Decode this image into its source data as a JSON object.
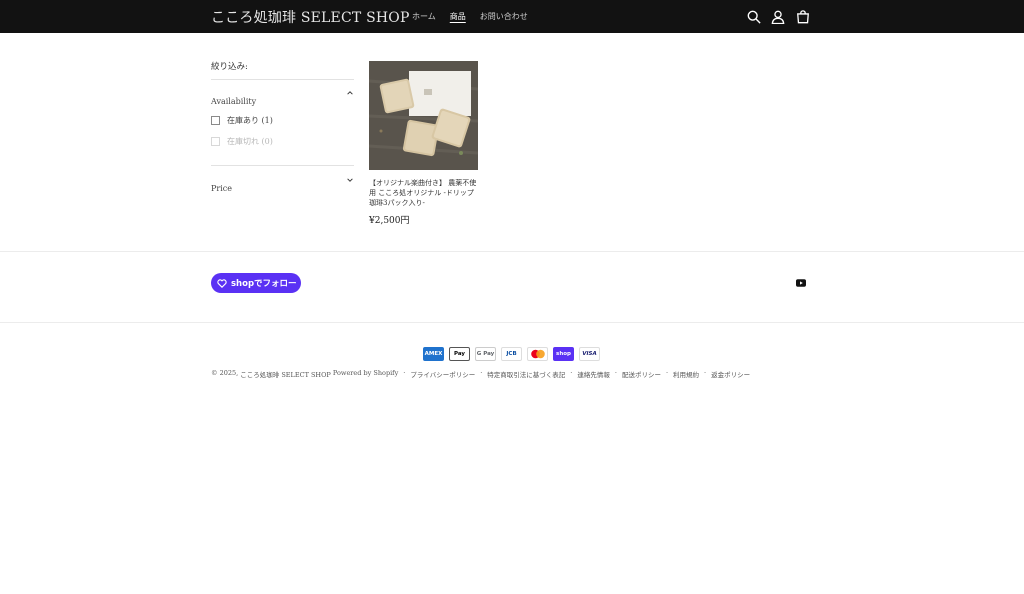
{
  "header": {
    "logo": "こころ処珈琲 SELECT SHOP",
    "nav": [
      "ホーム",
      "商品",
      "お問い合わせ"
    ],
    "active_nav": "商品",
    "icons": [
      "search-icon",
      "account-icon",
      "cart-icon"
    ]
  },
  "filter": {
    "title": "絞り込み:",
    "availability": {
      "label": "Availability",
      "options": [
        {
          "label": "在庫あり (1)",
          "enabled": true
        },
        {
          "label": "在庫切れ (0)",
          "enabled": false
        }
      ]
    },
    "price": {
      "label": "Price"
    }
  },
  "product": {
    "title": "【オリジナル楽曲付き】 農薬不使用 こころ処オリジナル -ドリップ珈琲3パック入り-",
    "price": "¥2,500円"
  },
  "follow": {
    "label": "shopでフォロー",
    "social_icon": "youtube-icon"
  },
  "footer": {
    "payment_methods": [
      "American Express",
      "Apple Pay",
      "Google Pay",
      "JCB",
      "Mastercard",
      "Shop Pay",
      "Visa"
    ],
    "payment_labels": [
      "AMEX",
      "Pay",
      "G Pay",
      "JCB",
      "",
      "shop",
      "VISA"
    ],
    "copyright_prefix": "© 2025,",
    "copyright_link": "こころ処珈琲 SELECT SHOP",
    "powered": "Powered by Shopify",
    "policies": [
      "プライバシーポリシー",
      "特定商取引法に基づく表記",
      "連絡先情報",
      "配送ポリシー",
      "利用規約",
      "返金ポリシー"
    ]
  },
  "colors": {
    "header_bg": "#121212",
    "shop_purple": "#5a31f4"
  }
}
